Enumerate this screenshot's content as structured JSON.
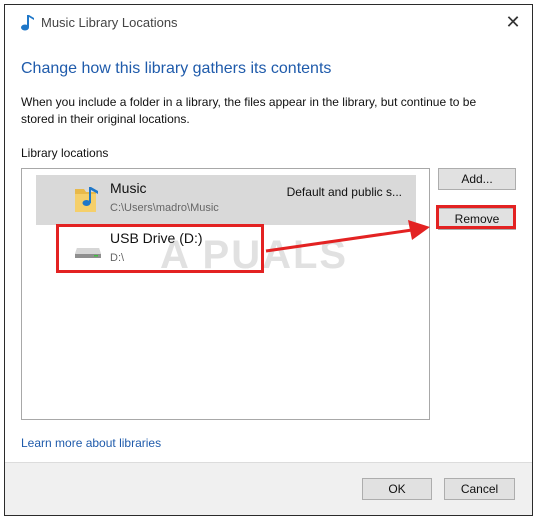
{
  "window": {
    "title": "Music Library Locations",
    "heading": "Change how this library gathers its contents",
    "description": "When you include a folder in a library, the files appear in the library, but continue to be stored in their original locations.",
    "section_label": "Library locations"
  },
  "locations": [
    {
      "name": "Music",
      "path": "C:\\Users\\madro\\Music",
      "status": "Default and public s...",
      "icon": "music-folder-icon",
      "selected": true
    },
    {
      "name": "USB Drive (D:)",
      "path": "D:\\",
      "status": "",
      "icon": "usb-drive-icon",
      "selected": false
    }
  ],
  "buttons": {
    "add": "Add...",
    "remove": "Remove",
    "ok": "OK",
    "cancel": "Cancel"
  },
  "link": {
    "learn_more": "Learn more about libraries"
  },
  "watermark": {
    "text": "A PUALS"
  },
  "colors": {
    "accent": "#1f5bab",
    "annotation": "#e32222",
    "selected_row": "#d9d9d9"
  }
}
